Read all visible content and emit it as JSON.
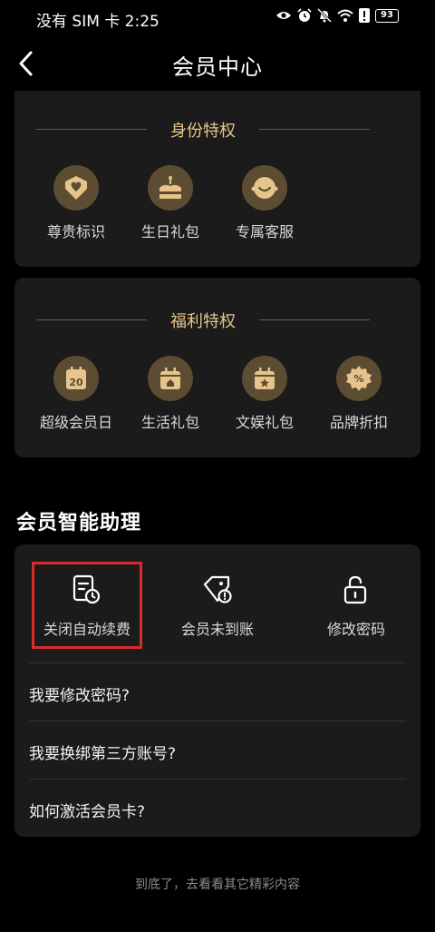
{
  "status_bar": {
    "carrier_time": "没有 SIM 卡 2:25",
    "battery": "93",
    "icons": [
      "eye-icon",
      "alarm-icon",
      "mute-icon",
      "wifi-icon",
      "alert-icon",
      "battery-icon"
    ]
  },
  "nav": {
    "title": "会员中心",
    "back_icon": "chevron-left-icon"
  },
  "identity_section": {
    "title": "身份特权",
    "items": [
      {
        "label": "尊贵标识",
        "icon": "heart-badge-icon"
      },
      {
        "label": "生日礼包",
        "icon": "cake-icon"
      },
      {
        "label": "专属客服",
        "icon": "smile-face-icon"
      }
    ]
  },
  "welfare_section": {
    "title": "福利特权",
    "items": [
      {
        "label": "超级会员日",
        "icon": "calendar-20-icon",
        "icon_text": "20"
      },
      {
        "label": "生活礼包",
        "icon": "gift-box-icon"
      },
      {
        "label": "文娱礼包",
        "icon": "star-box-icon"
      },
      {
        "label": "品牌折扣",
        "icon": "discount-badge-icon",
        "icon_text": "%"
      }
    ]
  },
  "assistant": {
    "title": "会员智能助理",
    "tools": [
      {
        "label": "关闭自动续费",
        "icon": "cancel-renewal-icon"
      },
      {
        "label": "会员未到账",
        "icon": "missing-tag-icon"
      },
      {
        "label": "修改密码",
        "icon": "unlock-icon"
      }
    ],
    "faqs": [
      "我要修改密码?",
      "我要换绑第三方账号?",
      "如何激活会员卡?"
    ]
  },
  "footer": {
    "text": "到底了，去看看其它精彩内容"
  },
  "colors": {
    "background": "#000000",
    "card": "#1b1b1b",
    "gold": "#e6c48b",
    "icon_circle": "#5c4c32",
    "highlight": "#d92b2b"
  }
}
